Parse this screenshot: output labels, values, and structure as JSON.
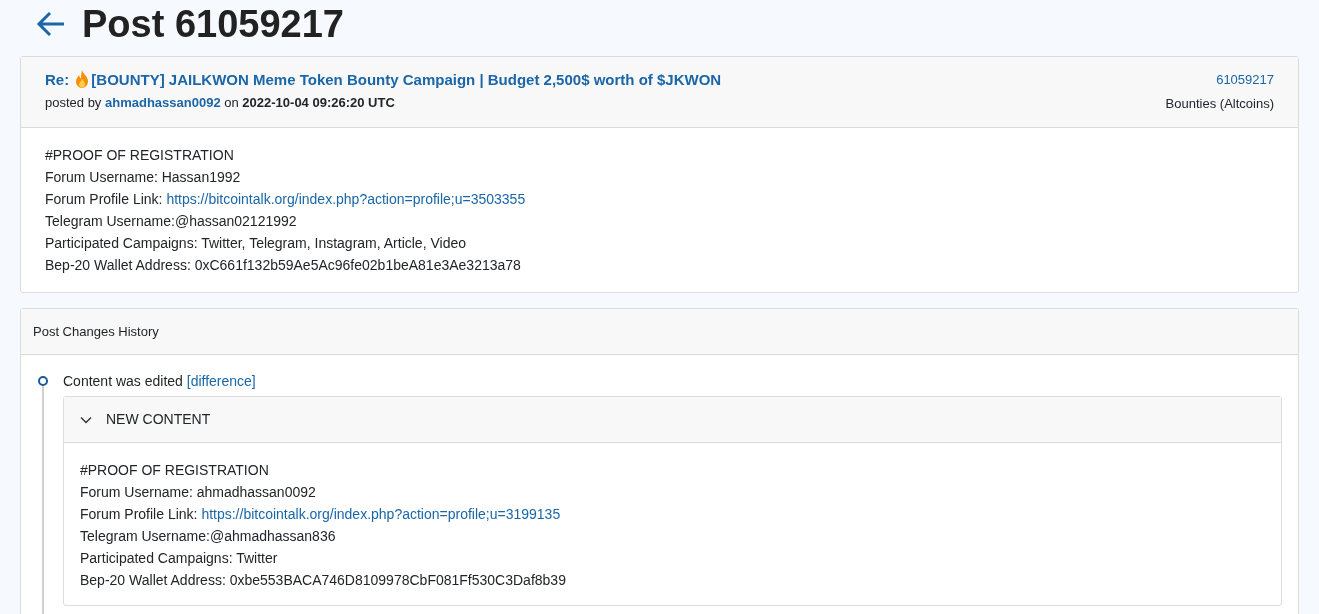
{
  "page_title": "Post 61059217",
  "post": {
    "title_prefix": "Re:",
    "title": "[BOUNTY] JAILKWON Meme Token Bounty Campaign | Budget 2,500$ worth of $JKWON",
    "byline": {
      "prefix": "posted by",
      "author": "ahmadhassan0092",
      "middle": "on",
      "date": "2022-10-04 09:26:20 UTC"
    },
    "post_id": "61059217",
    "board": "Bounties (Altcoins)",
    "lines": [
      {
        "text": "#PROOF OF REGISTRATION"
      },
      {
        "text": "Forum Username: Hassan1992"
      },
      {
        "text": "Forum Profile Link:",
        "link": "https://bitcointalk.org/index.php?action=profile;u=3503355"
      },
      {
        "text": "Telegram Username:@hassan02121992"
      },
      {
        "text": "Participated Campaigns: Twitter, Telegram, Instagram, Article, Video"
      },
      {
        "text": "Bep-20 Wallet Address: 0xC661f132b59Ae5Ac96fe02b1beA81e3Ae3213a78"
      }
    ]
  },
  "history": {
    "title": "Post Changes History",
    "events": [
      {
        "text": "Content was edited",
        "link": "[difference]",
        "panel": {
          "title": "NEW CONTENT",
          "expanded": true,
          "lines": [
            {
              "text": "#PROOF OF REGISTRATION"
            },
            {
              "text": "Forum Username: ahmadhassan0092"
            },
            {
              "text": "Forum Profile Link:",
              "link": "https://bitcointalk.org/index.php?action=profile;u=3199135"
            },
            {
              "text": "Telegram Username:@ahmadhassan836"
            },
            {
              "text": "Participated Campaigns: Twitter"
            },
            {
              "text": "Bep-20 Wallet Address: 0xbe553BACA746D8109978CbF081Ff530C3Daf8b39"
            }
          ]
        }
      }
    ]
  }
}
